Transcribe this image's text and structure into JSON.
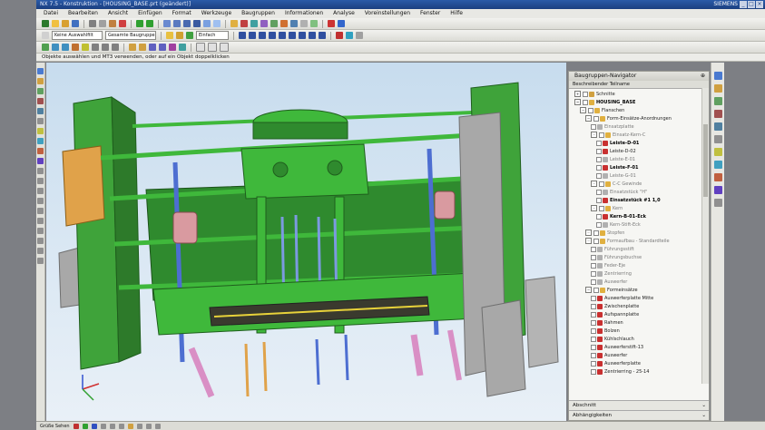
{
  "window": {
    "title": "NX 7.5 - Konstruktion - [HOUSING_BASE.prt (geändert)]",
    "brand": "SIEMENS",
    "controls": [
      "_",
      "□",
      "×"
    ]
  },
  "menubar": [
    "Datei",
    "Bearbeiten",
    "Ansicht",
    "Einfügen",
    "Format",
    "Werkzeuge",
    "Baugruppen",
    "Informationen",
    "Analyse",
    "Voreinstellungen",
    "Fenster",
    "Hilfe"
  ],
  "toolbar": {
    "filter_combo": "Keine Auswahlfilt",
    "assembly_combo": "Gesamte Baugruppe",
    "snap_label": "Einfach"
  },
  "hint_text": "Objekte auswählen und MT3 verwenden, oder auf ein Objekt doppelklicken",
  "navigator": {
    "title": "Baugruppen-Navigator",
    "pin": "⊕",
    "column_header": "Beschreibender Teilname",
    "rows": [
      {
        "label": "Schnitte",
        "indent": 1,
        "icon": "section",
        "style": "normal",
        "expander": "+"
      },
      {
        "label": "HOUSING_BASE",
        "indent": 1,
        "icon": "assembly",
        "style": "bold",
        "expander": "−"
      },
      {
        "label": "Flanschen",
        "indent": 2,
        "icon": "assembly",
        "style": "normal",
        "expander": "−"
      },
      {
        "label": "Form-Einsätze-Anordnungen",
        "indent": 3,
        "icon": "assembly",
        "style": "normal",
        "expander": "−"
      },
      {
        "label": "Einsatzplatte",
        "indent": 4,
        "icon": "part",
        "style": "dim",
        "expander": ""
      },
      {
        "label": "Einsatz-Kern-C",
        "indent": 4,
        "icon": "assembly",
        "style": "dim",
        "expander": "−"
      },
      {
        "label": "Leiste-D-01",
        "indent": 5,
        "icon": "part-red",
        "style": "bold",
        "expander": ""
      },
      {
        "label": "Leiste-D-02",
        "indent": 5,
        "icon": "part-red",
        "style": "normal",
        "expander": ""
      },
      {
        "label": "Leiste-E-01",
        "indent": 5,
        "icon": "part",
        "style": "dim",
        "expander": ""
      },
      {
        "label": "Leiste-F-01",
        "indent": 5,
        "icon": "part-red",
        "style": "bold",
        "expander": ""
      },
      {
        "label": "Leiste-G-01",
        "indent": 5,
        "icon": "part",
        "style": "dim",
        "expander": ""
      },
      {
        "label": "C-C Gewinde",
        "indent": 4,
        "icon": "assembly",
        "style": "dim",
        "expander": "−"
      },
      {
        "label": "Einsatzstück \"H\"",
        "indent": 5,
        "icon": "part",
        "style": "dim",
        "expander": ""
      },
      {
        "label": "Einsatzstück #1 1,0",
        "indent": 5,
        "icon": "part-red",
        "style": "bold",
        "expander": ""
      },
      {
        "label": "Kern",
        "indent": 4,
        "icon": "assembly",
        "style": "dim",
        "expander": "−"
      },
      {
        "label": "Kern-B-01-Eck",
        "indent": 5,
        "icon": "part-red",
        "style": "bold",
        "expander": ""
      },
      {
        "label": "Kern-Stift-Eck",
        "indent": 5,
        "icon": "part",
        "style": "dim",
        "expander": ""
      },
      {
        "label": "Stopfen",
        "indent": 3,
        "icon": "assembly",
        "style": "dim",
        "expander": "−"
      },
      {
        "label": "Formaufbau - Standardteile",
        "indent": 3,
        "icon": "assembly",
        "style": "dim",
        "expander": "−"
      },
      {
        "label": "Führungsstift",
        "indent": 4,
        "icon": "part",
        "style": "dim",
        "expander": ""
      },
      {
        "label": "Führungsbuchse",
        "indent": 4,
        "icon": "part",
        "style": "dim",
        "expander": ""
      },
      {
        "label": "Feder-Eje",
        "indent": 4,
        "icon": "part",
        "style": "dim",
        "expander": ""
      },
      {
        "label": "Zentrierring",
        "indent": 4,
        "icon": "part",
        "style": "dim",
        "expander": ""
      },
      {
        "label": "Auswerfer",
        "indent": 4,
        "icon": "part",
        "style": "dim",
        "expander": ""
      },
      {
        "label": "Formeinsätze",
        "indent": 3,
        "icon": "assembly",
        "style": "normal",
        "expander": "−"
      },
      {
        "label": "Auswerferplatte Mitte",
        "indent": 4,
        "icon": "part-red",
        "style": "normal",
        "expander": ""
      },
      {
        "label": "Zwischenplatte",
        "indent": 4,
        "icon": "part-red",
        "style": "normal",
        "expander": ""
      },
      {
        "label": "Aufspannplatte",
        "indent": 4,
        "icon": "part-red",
        "style": "normal",
        "expander": ""
      },
      {
        "label": "Rahmen",
        "indent": 4,
        "icon": "part-red",
        "style": "normal",
        "expander": ""
      },
      {
        "label": "Bolzen",
        "indent": 4,
        "icon": "part-red",
        "style": "normal",
        "expander": ""
      },
      {
        "label": "Kühlschlauch",
        "indent": 4,
        "icon": "part-red",
        "style": "normal",
        "expander": ""
      },
      {
        "label": "Auswerferstift-13",
        "indent": 4,
        "icon": "part-red",
        "style": "normal",
        "expander": ""
      },
      {
        "label": "Auswerfer",
        "indent": 4,
        "icon": "part-red",
        "style": "normal",
        "expander": ""
      },
      {
        "label": "Auswerferplatte",
        "indent": 4,
        "icon": "part-red",
        "style": "normal",
        "expander": ""
      },
      {
        "label": "Zentrierring - 25-14",
        "indent": 4,
        "icon": "part-red",
        "style": "normal",
        "expander": ""
      }
    ],
    "footer": [
      {
        "label": "Abschnitt",
        "chevron": "⌄"
      },
      {
        "label": "Abhängigkeiten",
        "chevron": "⌄"
      }
    ]
  },
  "statusbar": {
    "text": "Grüße Sehen"
  },
  "colors": {
    "model_green": "#3fb83b",
    "model_dark_green": "#2f8a2e",
    "plate_gray": "#9b9b9b",
    "accent_orange": "#e0a24a",
    "pipe_blue": "#4d6ed1",
    "pipe_pink": "#d98fc5",
    "viewport_bg": "#c7dcee"
  }
}
